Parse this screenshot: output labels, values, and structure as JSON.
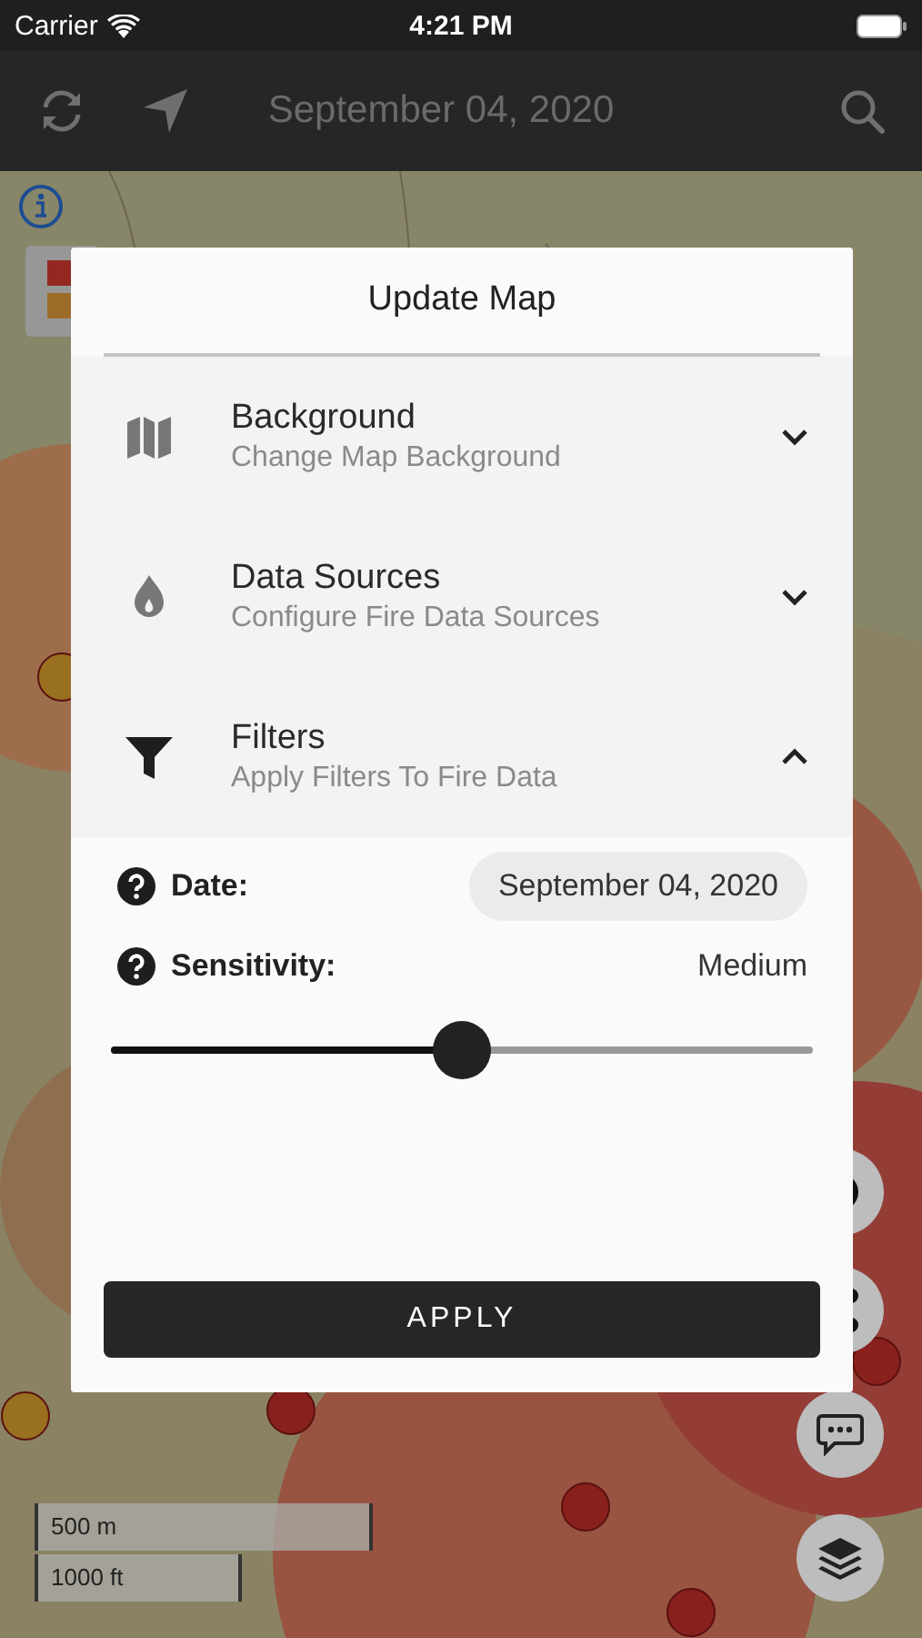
{
  "status_bar": {
    "carrier": "Carrier",
    "time": "4:21 PM"
  },
  "nav_bar": {
    "title": "September 04, 2020"
  },
  "map_overlay": {
    "scale_bar": [
      "500 m",
      "1000 ft"
    ]
  },
  "dialog": {
    "title": "Update Map",
    "sections": [
      {
        "kind": "map",
        "title": "Background",
        "subtitle": "Change Map Background",
        "expanded": false
      },
      {
        "kind": "flame",
        "title": "Data Sources",
        "subtitle": "Configure Fire Data Sources",
        "expanded": false
      },
      {
        "kind": "funnel",
        "title": "Filters",
        "subtitle": "Apply Filters To Fire Data",
        "expanded": true
      }
    ],
    "filters": {
      "date_label": "Date:",
      "date_value": "September 04, 2020",
      "sensitivity_label": "Sensitivity:",
      "sensitivity_value": "Medium",
      "sensitivity": {
        "level": 0.5
      }
    },
    "apply_button": "APPLY"
  }
}
